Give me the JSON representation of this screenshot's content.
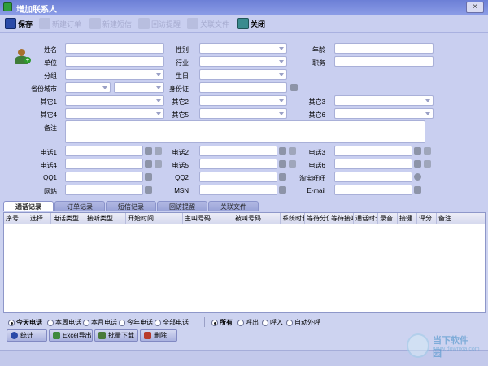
{
  "window": {
    "title": "增加联系人",
    "close_glyph": "×"
  },
  "toolbar": {
    "items": [
      {
        "label": "保存",
        "icon": "save-icon",
        "enabled": true
      },
      {
        "label": "新建订单",
        "icon": "order-icon",
        "enabled": false
      },
      {
        "label": "新建短信",
        "icon": "sms-icon",
        "enabled": false
      },
      {
        "label": "回访提醒",
        "icon": "reminder-icon",
        "enabled": false
      },
      {
        "label": "关联文件",
        "icon": "file-icon",
        "enabled": false
      },
      {
        "label": "关闭",
        "icon": "close-icon",
        "enabled": true
      }
    ]
  },
  "form": {
    "labels": {
      "name": "姓名",
      "gender": "性别",
      "age": "年龄",
      "company": "单位",
      "industry": "行业",
      "position": "职务",
      "group": "分组",
      "birthday": "生日",
      "province_city": "省份城市",
      "id_card": "身份证",
      "other1": "其它1",
      "other2": "其它2",
      "other3": "其它3",
      "other4": "其它4",
      "other5": "其它5",
      "other6": "其它6",
      "remark": "备注",
      "phone1": "电话1",
      "phone2": "电话2",
      "phone3": "电话3",
      "phone4": "电话4",
      "phone5": "电话5",
      "phone6": "电话6",
      "qq1": "QQ1",
      "qq2": "QQ2",
      "wangwang": "淘宝旺旺",
      "website": "网站",
      "msn": "MSN",
      "email": "E-mail"
    }
  },
  "tabs": [
    "通话记录",
    "订单记录",
    "短信记录",
    "回访提醒",
    "关联文件"
  ],
  "grid": {
    "columns": [
      "序号",
      "选择",
      "电话类型",
      "接听类型",
      "开始时间",
      "主叫号码",
      "被叫号码",
      "系统时长",
      "等待分值",
      "等待接听",
      "通话时长",
      "录音",
      "接键",
      "评分",
      "备注"
    ]
  },
  "filters": {
    "period": [
      "今天电话",
      "本周电话",
      "本月电话",
      "今年电话",
      "全部电话"
    ],
    "direction": [
      "所有",
      "呼出",
      "呼入",
      "自动外呼"
    ]
  },
  "actions": [
    "统计",
    "Excel导出",
    "批量下载",
    "删除"
  ],
  "watermark": {
    "title": "当下软件园",
    "url": "www.downxia.com"
  }
}
